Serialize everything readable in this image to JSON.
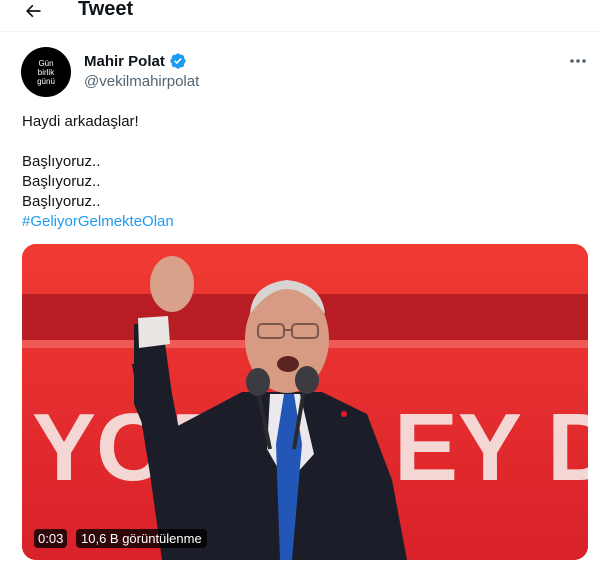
{
  "header": {
    "title": "Tweet",
    "back_icon": "arrow-left-icon"
  },
  "author": {
    "name": "Mahir Polat",
    "handle": "@vekilmahirpolat",
    "verified_color": "#1d9bf0",
    "avatar_lines": [
      "Gün",
      "birlik",
      "günü"
    ]
  },
  "tweet": {
    "line1": "Haydi arkadaşlar!",
    "line2": "Başlıyoruz..",
    "line3": "Başlıyoruz..",
    "line4": "Başlıyoruz..",
    "hashtag": "#GeliyorGelmekteOlan"
  },
  "media": {
    "time": "0:03",
    "views": "10,6 B görüntülenme",
    "background_letters": [
      "YOR",
      "EY D"
    ],
    "bg_color": "#e6262b"
  },
  "colors": {
    "accent": "#1d9bf0",
    "text": "#0f1419",
    "muted": "#536471"
  }
}
